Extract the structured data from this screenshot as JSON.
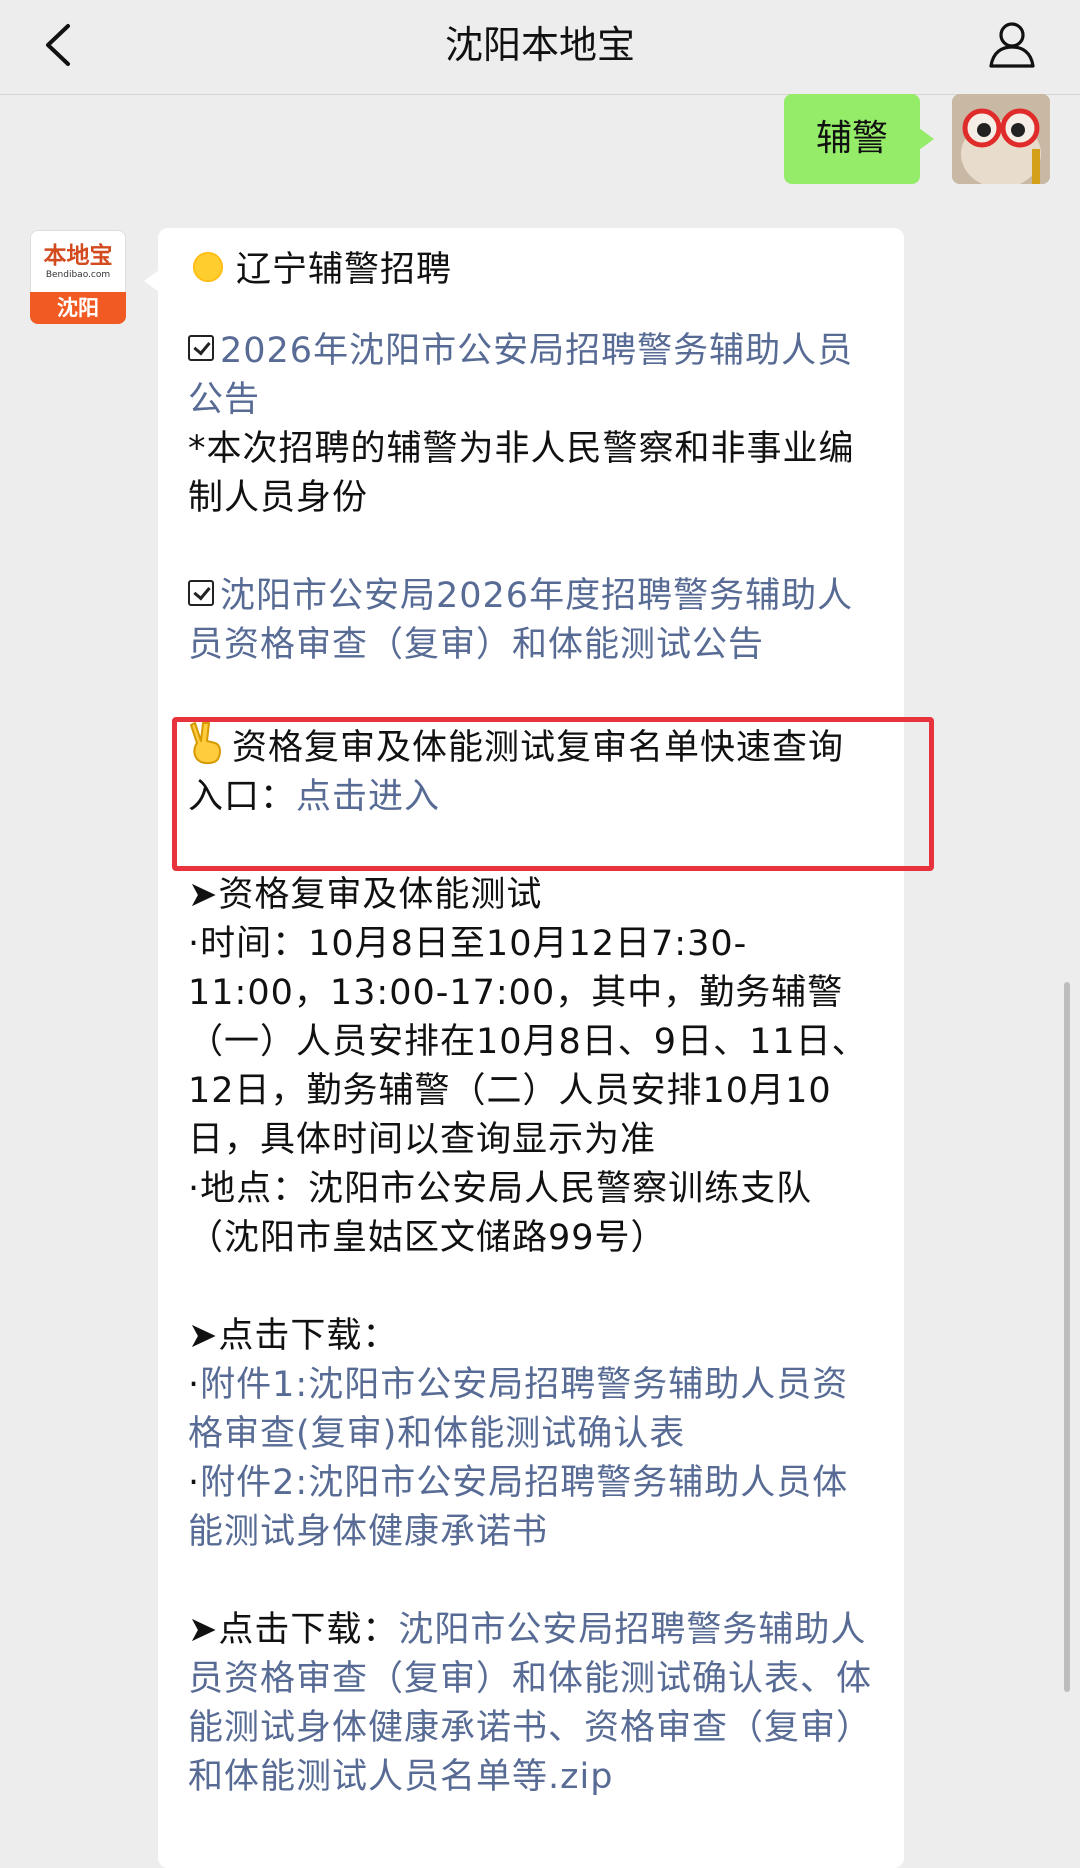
{
  "header": {
    "title": "沈阳本地宝"
  },
  "user_message": {
    "text": "辅警"
  },
  "bot_avatar": {
    "logo_text": "本地宝",
    "logo_sub": "Bendibao.com",
    "city": "沈阳"
  },
  "bot_message": {
    "heading": "辽宁辅警招聘",
    "link1": "2026年沈阳市公安局招聘警务辅助人员公告",
    "note1": "*本次招聘的辅警为非人民警察和非事业编制人员身份",
    "link2": "沈阳市公安局2026年度招聘警务辅助人员资格审查（复审）和体能测试公告",
    "query_prefix": "资格复审及体能测试复审名单快速查询入口：",
    "query_link": "点击进入",
    "section1_title": "➤资格复审及体能测试",
    "time_text": "·时间：10月8日至10月12日7:30-11:00，13:00-17:00，其中，勤务辅警（一）人员安排在10月8日、9日、11日、12日，勤务辅警（二）人员安排10月10日，具体时间以查询显示为准",
    "place_text": "·地点：沈阳市公安局人民警察训练支队（沈阳市皇姑区文储路99号）",
    "download1_title": "➤点击下载：",
    "attach1": "附件1:沈阳市公安局招聘警务辅助人员资格审查(复审)和体能测试确认表",
    "attach2": "附件2:沈阳市公安局招聘警务辅助人员体能测试身体健康承诺书",
    "download2_prefix": "➤点击下载：",
    "download2_link": "沈阳市公安局招聘警务辅助人员资格审查（复审）和体能测试确认表、体能测试身体健康承诺书、资格审查（复审）和体能测试人员名单等.zip",
    "dot": "·"
  },
  "colors": {
    "link": "#576b95",
    "user_bubble": "#95ec69",
    "highlight": "#e8323c"
  },
  "icons": {
    "back": "chevron-left-icon",
    "profile": "user-icon",
    "sun": "sun-emoji-icon",
    "victory": "victory-hand-emoji-icon",
    "checkbox": "checkbox-icon"
  }
}
